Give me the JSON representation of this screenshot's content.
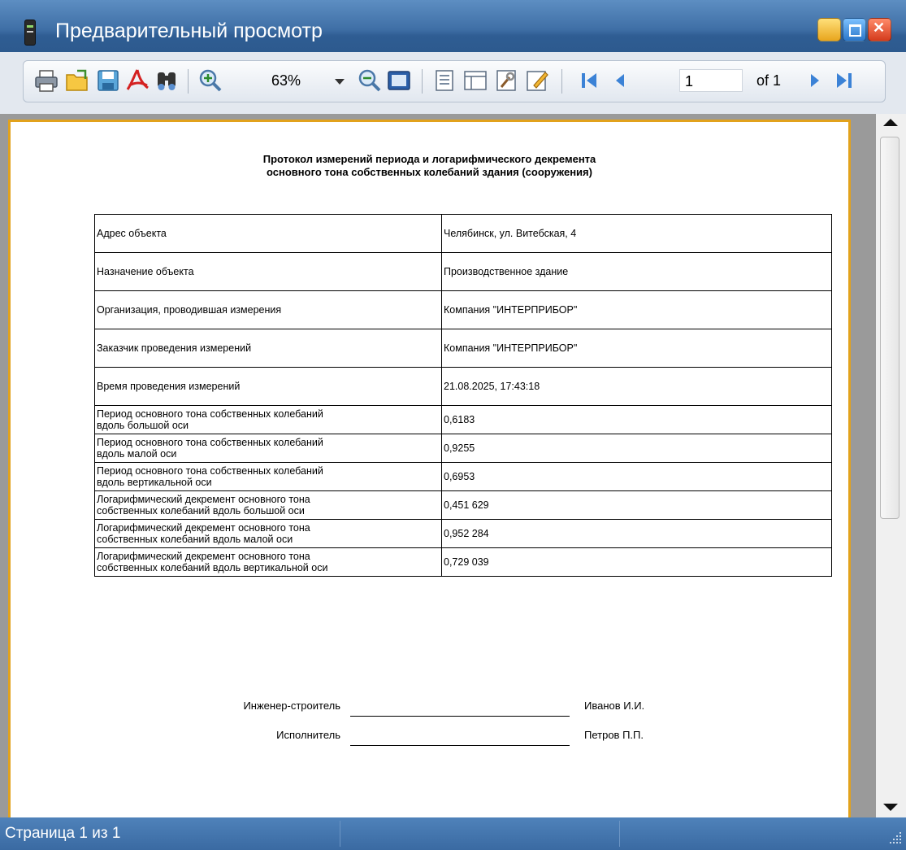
{
  "window": {
    "title": "Предварительный просмотр"
  },
  "toolbar": {
    "zoom_value": "63%",
    "page_number": "1",
    "page_of": "of 1",
    "icons": [
      "print-icon",
      "open-icon",
      "save-icon",
      "pdf-icon",
      "find-icon",
      "zoom-in-icon",
      "zoom-out-icon",
      "page-width-icon",
      "page-setup-icon",
      "page-layout-icon",
      "parameters-icon",
      "edit-icon",
      "first-page-icon",
      "prev-page-icon",
      "next-page-icon",
      "last-page-icon"
    ]
  },
  "document": {
    "title_line1": "Протокол измерений периода и логарифмического декремента",
    "title_line2": "основного тона собственных колебаний здания (сооружения)",
    "rows": [
      {
        "key": "Адрес объекта",
        "value": "Челябинск, ул. Витебская, 4"
      },
      {
        "key": "Назначение объекта",
        "value": "Производственное здание"
      },
      {
        "key": "Организация, проводившая измерения",
        "value": "Компания \"ИНТЕРПРИБОР\""
      },
      {
        "key": "Заказчик проведения измерений",
        "value": "Компания \"ИНТЕРПРИБОР\""
      },
      {
        "key": "Время проведения измерений",
        "value": "21.08.2025, 17:43:18"
      },
      {
        "key_line1": "Период основного тона собственных колебаний",
        "key_line2": "вдоль большой оси",
        "value": "0,6183"
      },
      {
        "key_line1": "Период основного тона собственных колебаний",
        "key_line2": "вдоль малой оси",
        "value": "0,9255"
      },
      {
        "key_line1": "Период основного тона собственных колебаний",
        "key_line2": "вдоль вертикальной оси",
        "value": "0,6953"
      },
      {
        "key_line1": "Логарифмический декремент основного тона",
        "key_line2": "собственных колебаний вдоль большой оси",
        "value": "0,451 629"
      },
      {
        "key_line1": "Логарифмический декремент основного тона",
        "key_line2": "собственных колебаний вдоль малой оси",
        "value": "0,952 284"
      },
      {
        "key_line1": "Логарифмический декремент основного тона",
        "key_line2": "собственных колебаний вдоль вертикальной оси",
        "value": "0,729 039"
      }
    ],
    "signatures": [
      {
        "role": "Инженер-строитель",
        "name": "Иванов И.И."
      },
      {
        "role": "Исполнитель",
        "name": "Петров П.П."
      }
    ]
  },
  "status": {
    "text": "Страница 1 из 1"
  },
  "colors": {
    "titlebar": "#3f6fa6",
    "page_border": "#e2a21c",
    "statusbar": "#3a6aa2"
  }
}
